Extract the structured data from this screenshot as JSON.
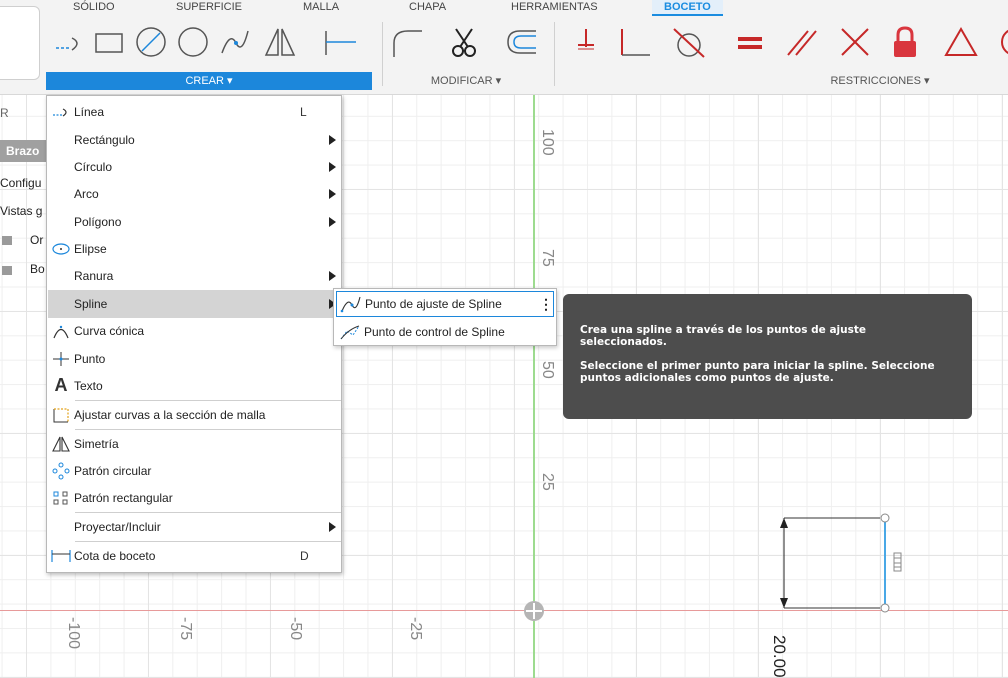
{
  "toolbar": {
    "tabs": [
      "SÓLIDO",
      "SUPERFICIE",
      "MALLA",
      "CHAPA",
      "HERRAMIENTAS",
      "BOCETO"
    ],
    "active_tab": "BOCETO",
    "groups": {
      "crear": "CREAR ▾",
      "modificar": "MODIFICAR ▾",
      "restricciones": "RESTRICCIONES ▾"
    },
    "accent_color": "#1c87db"
  },
  "browser": {
    "search_fragment": "R",
    "component": "Brazo",
    "items": [
      "Configu",
      "Vistas g",
      "Or",
      "Bo"
    ]
  },
  "menu": {
    "items": [
      {
        "label": "Línea",
        "key": "L",
        "icon": "line-icon"
      },
      {
        "label": "Rectángulo",
        "submenu": true
      },
      {
        "label": "Círculo",
        "submenu": true
      },
      {
        "label": "Arco",
        "submenu": true
      },
      {
        "label": "Polígono",
        "submenu": true
      },
      {
        "label": "Elipse",
        "icon": "ellipse-icon"
      },
      {
        "label": "Ranura",
        "submenu": true
      },
      {
        "label": "Spline",
        "submenu": true,
        "highlighted": true
      },
      {
        "label": "Curva cónica",
        "icon": "conic-icon"
      },
      {
        "label": "Punto",
        "icon": "point-icon"
      },
      {
        "label": "Texto",
        "icon": "text-icon"
      },
      {
        "label": "Ajustar curvas a la sección de malla",
        "icon": "fit-curves-icon"
      },
      {
        "label": "Simetría",
        "icon": "mirror-icon"
      },
      {
        "label": "Patrón circular",
        "icon": "circular-pattern-icon"
      },
      {
        "label": "Patrón rectangular",
        "icon": "rectangular-pattern-icon"
      },
      {
        "label": "Proyectar/Incluir",
        "submenu": true
      },
      {
        "label": "Cota de boceto",
        "key": "D",
        "icon": "dimension-icon"
      }
    ]
  },
  "submenu": {
    "items": [
      {
        "label": "Punto de ajuste de Spline",
        "icon": "fit-point-spline-icon"
      },
      {
        "label": "Punto de control de Spline",
        "icon": "control-point-spline-icon"
      }
    ],
    "more": "⋮"
  },
  "tooltip": {
    "line1": "Crea una spline a través de los puntos de ajuste seleccionados.",
    "line2": "Seleccione el primer punto para iniciar la spline. Seleccione puntos adicionales como puntos de ajuste."
  },
  "canvas": {
    "y_ticks": [
      "100",
      "75",
      "50",
      "25"
    ],
    "x_ticks": [
      "-100",
      "-75",
      "-50",
      "-25"
    ],
    "dimension": "20.00"
  }
}
